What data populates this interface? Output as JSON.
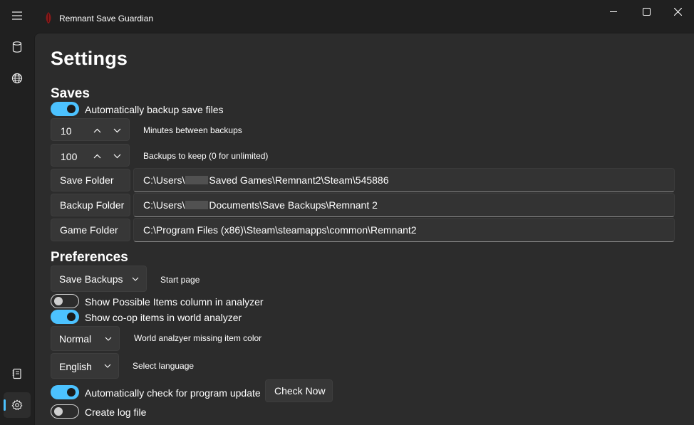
{
  "app": {
    "title": "Remnant Save Guardian"
  },
  "page": {
    "title": "Settings"
  },
  "saves": {
    "heading": "Saves",
    "auto_backup": {
      "label": "Automatically backup save files",
      "on": true
    },
    "minutes": {
      "value": "10",
      "label": "Minutes between backups"
    },
    "keep": {
      "value": "100",
      "label": "Backups to keep (0 for unlimited)"
    },
    "save_folder": {
      "button": "Save Folder",
      "path_prefix": "C:\\Users\\",
      "path_suffix": "Saved Games\\Remnant2\\Steam\\545886"
    },
    "backup_folder": {
      "button": "Backup Folder",
      "path_prefix": "C:\\Users\\",
      "path_suffix": "Documents\\Save Backups\\Remnant 2"
    },
    "game_folder": {
      "button": "Game Folder",
      "path": "C:\\Program Files (x86)\\Steam\\steamapps\\common\\Remnant2"
    }
  },
  "preferences": {
    "heading": "Preferences",
    "start_page": {
      "value": "Save Backups",
      "label": "Start page"
    },
    "possible_items": {
      "label": "Show Possible Items column in analyzer",
      "on": false
    },
    "coop_items": {
      "label": "Show co-op items in world analyzer",
      "on": true
    },
    "missing_color": {
      "value": "Normal",
      "label": "World analzyer missing item color"
    },
    "language": {
      "value": "English",
      "label": "Select language"
    },
    "auto_update": {
      "label": "Automatically check for program update",
      "on": true,
      "button": "Check Now"
    },
    "log_file": {
      "label": "Create log file",
      "on": false
    }
  },
  "colors": {
    "accent": "#4cc2ff",
    "app_icon": "#8b1a1a"
  },
  "icons": {
    "menu": "hamburger-menu-icon",
    "saves": "database-icon",
    "world": "globe-icon",
    "log": "notebook-icon",
    "settings": "gear-icon"
  }
}
